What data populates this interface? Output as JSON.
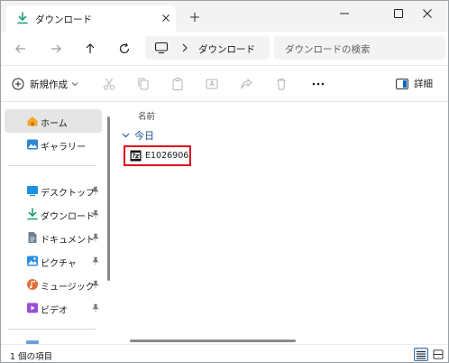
{
  "tab": {
    "title": "ダウンロード",
    "icon": "download-icon"
  },
  "window_controls": {
    "minimize": "minimize-icon",
    "maximize": "maximize-icon",
    "close": "close-icon"
  },
  "address": {
    "location": "ダウンロード",
    "search_placeholder": "ダウンロードの検索"
  },
  "commands": {
    "new_label": "新規作成",
    "details_label": "詳細",
    "icons": [
      "cut-icon",
      "copy-icon",
      "paste-icon",
      "rename-icon",
      "share-icon",
      "delete-icon",
      "more-icon"
    ]
  },
  "sidebar": {
    "items": [
      {
        "label": "ホーム",
        "icon": "home-icon",
        "selected": true
      },
      {
        "label": "ギャラリー",
        "icon": "gallery-icon"
      },
      {
        "label": "デスクトップ",
        "icon": "desktop-icon",
        "pinned": true
      },
      {
        "label": "ダウンロード",
        "icon": "download-icon",
        "pinned": true
      },
      {
        "label": "ドキュメント",
        "icon": "documents-icon",
        "pinned": true
      },
      {
        "label": "ピクチャ",
        "icon": "pictures-icon",
        "pinned": true
      },
      {
        "label": "ミュージック",
        "icon": "music-icon",
        "pinned": true
      },
      {
        "label": "ビデオ",
        "icon": "videos-icon",
        "pinned": true
      }
    ]
  },
  "content": {
    "column_header": "名前",
    "group": "今日",
    "files": [
      {
        "name": "E1026906",
        "icon": "7z-archive-icon"
      }
    ]
  },
  "status": {
    "item_count": "1 個の項目"
  },
  "colors": {
    "highlight_border": "#e0001b",
    "accent": "#0067c0",
    "group_text": "#1b4e8c"
  }
}
